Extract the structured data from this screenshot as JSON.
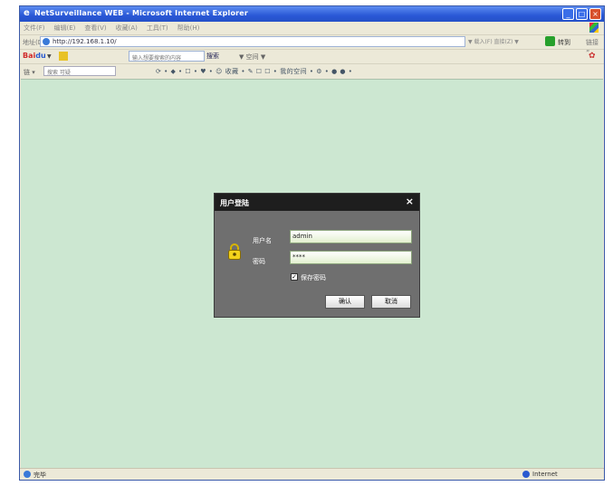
{
  "window": {
    "title": "NetSurveillance WEB - Microsoft Internet Explorer",
    "controls": [
      "_",
      "□",
      "×"
    ]
  },
  "menubar": {
    "items": [
      "文件(F)",
      "编辑(E)",
      "查看(V)",
      "收藏(A)",
      "工具(T)",
      "帮助(H)"
    ]
  },
  "addressbar": {
    "label": "地址(D)",
    "url": "http://192.168.1.10/",
    "right_text": "▼ 载入(F)  直接(Z)  ▼",
    "go_label": "转到",
    "links_label": "链接 »"
  },
  "baidubar": {
    "logo_left": "Bai",
    "logo_right": "du",
    "search_placeholder": "输入想要搜索的内容",
    "search_button": "搜索",
    "more": "▼  空间  ▼"
  },
  "toolbar3": {
    "left": "链 ▾",
    "input_placeholder": "搜索 可疑",
    "icons_text": "⟳ • ◆ • ☐ • ♥ • ☺ 收藏 • ✎ ☐ ☐ • 我的空间 • ⚙ • ● ● •"
  },
  "dialog": {
    "title": "用户登陆",
    "close": "×",
    "username_label": "用户名",
    "username_value": "admin",
    "password_label": "密码",
    "password_value": "****",
    "remember_label": "保存密码",
    "remember_checked": "✓",
    "ok_label": "确认",
    "cancel_label": "取消"
  },
  "statusbar": {
    "left_text": "完毕",
    "zone_text": "Internet"
  },
  "colors": {
    "page_background": "#cce7d1",
    "dialog_body": "#6f6f6f",
    "dialog_title": "#1e1e1e",
    "titlebar_blue": "#2a58d6"
  }
}
